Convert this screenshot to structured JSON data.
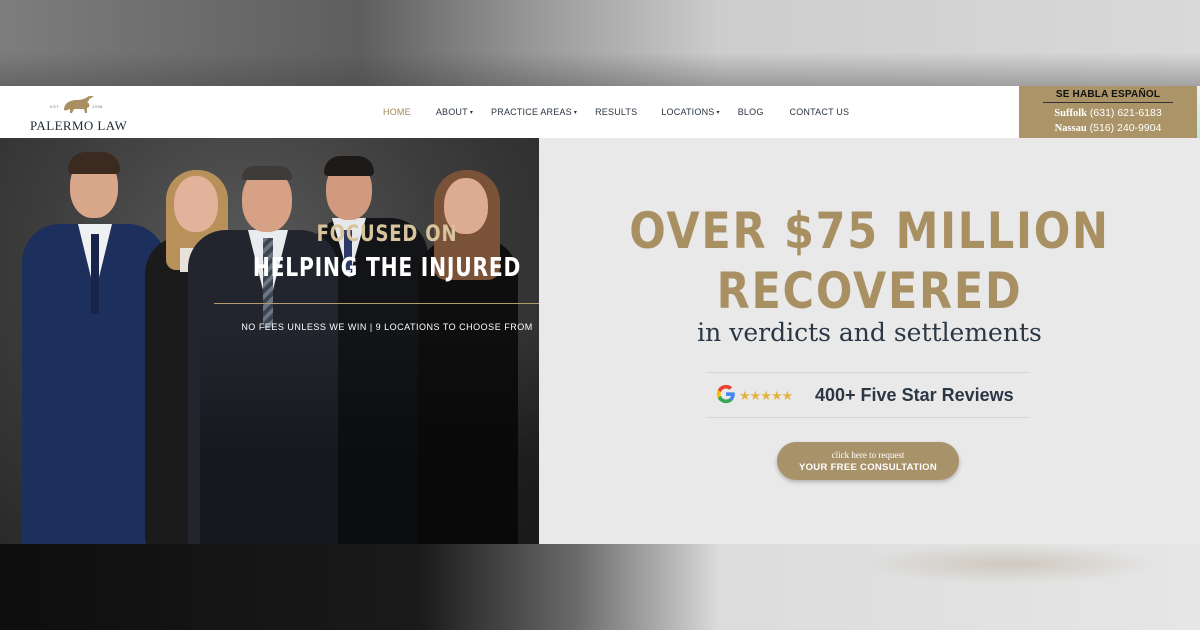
{
  "brand": {
    "logo_est": "EST.",
    "logo_year": "1998",
    "name": "PALERMO LAW"
  },
  "nav": {
    "items": [
      {
        "label": "HOME",
        "active": true,
        "dropdown": false
      },
      {
        "label": "ABOUT",
        "active": false,
        "dropdown": true
      },
      {
        "label": "PRACTICE AREAS",
        "active": false,
        "dropdown": true
      },
      {
        "label": "RESULTS",
        "active": false,
        "dropdown": false
      },
      {
        "label": "LOCATIONS",
        "active": false,
        "dropdown": true
      },
      {
        "label": "BLOG",
        "active": false,
        "dropdown": false
      },
      {
        "label": "CONTACT US",
        "active": false,
        "dropdown": false
      }
    ]
  },
  "contact": {
    "language_note": "SE HABLA ESPAÑOL",
    "suffolk_label": "Suffolk",
    "suffolk_phone": "(631) 621-6183",
    "nassau_label": "Nassau",
    "nassau_phone": "(516) 240-9904"
  },
  "hero_left": {
    "line1": "FOCUSED ON",
    "line2": "HELPING THE INJURED",
    "subline": "NO FEES UNLESS WE WIN | 9 LOCATIONS TO CHOOSE FROM"
  },
  "hero_right": {
    "headline_line1": "OVER $75 MILLION",
    "headline_line2": "RECOVERED",
    "subheadline": "in verdicts and settlements",
    "stars": "★★★★★",
    "reviews_text": "400+ Five Star Reviews",
    "cta_small": "click here to request",
    "cta_big": "YOUR FREE CONSULTATION"
  },
  "colors": {
    "gold": "#a99063",
    "navy_text": "#2b3745",
    "cta_bg": "#a8926a",
    "phone_box": "#aa9468"
  },
  "icons": {
    "logo": "bull-icon",
    "review_source": "google-g-icon",
    "dropdown": "caret-down-icon"
  }
}
